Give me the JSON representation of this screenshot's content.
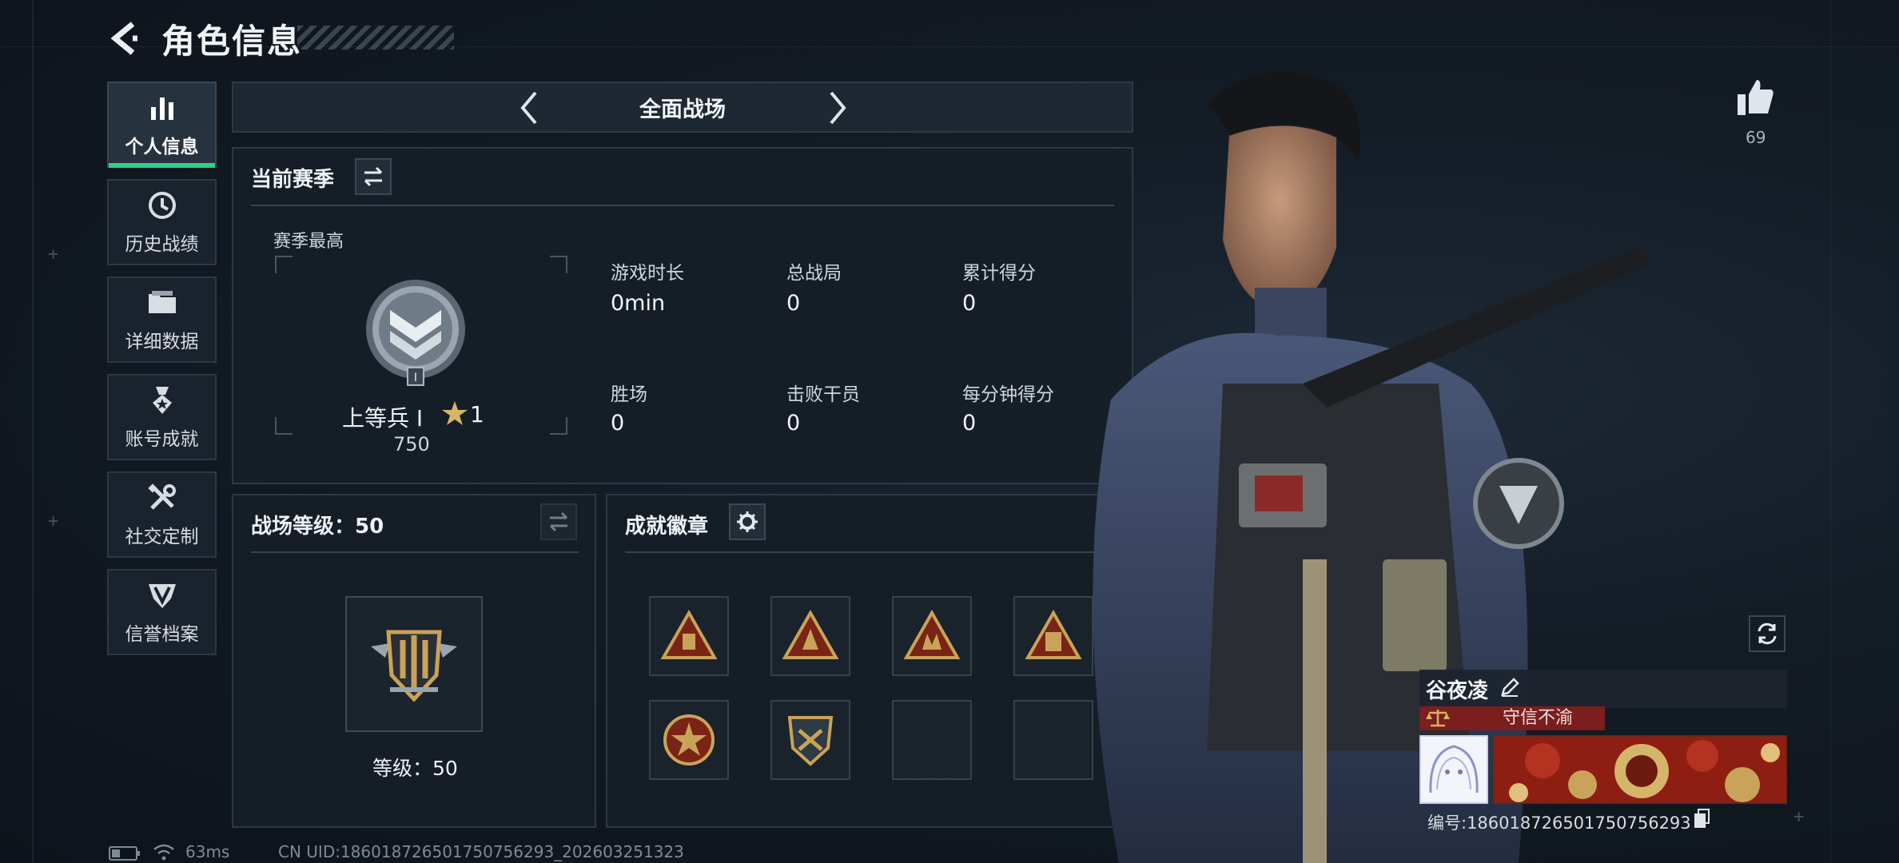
{
  "header": {
    "title": "角色信息"
  },
  "sidebar": {
    "items": [
      {
        "label": "个人信息",
        "icon": "bar-chart-icon"
      },
      {
        "label": "历史战绩",
        "icon": "history-clock-icon"
      },
      {
        "label": "详细数据",
        "icon": "folder-icon"
      },
      {
        "label": "账号成就",
        "icon": "achievement-medal-icon"
      },
      {
        "label": "社交定制",
        "icon": "tools-icon"
      },
      {
        "label": "信誉档案",
        "icon": "credibility-shield-icon"
      }
    ]
  },
  "mode": {
    "title": "全面战场"
  },
  "season": {
    "title": "当前赛季",
    "best_label": "赛季最高",
    "rank_name": "上等兵 Ⅰ",
    "stars": "1",
    "rank_points": "750",
    "stats": [
      {
        "label": "游戏时长",
        "value": "0min"
      },
      {
        "label": "总战局",
        "value": "0"
      },
      {
        "label": "累计得分",
        "value": "0"
      },
      {
        "label": "胜场",
        "value": "0"
      },
      {
        "label": "击败干员",
        "value": "0"
      },
      {
        "label": "每分钟得分",
        "value": "0"
      }
    ]
  },
  "battlefield_level": {
    "title": "战场等级：50",
    "level_text": "等级：50"
  },
  "achievements": {
    "title": "成就徽章"
  },
  "likes": {
    "count": "69"
  },
  "profile": {
    "name": "谷夜凌",
    "trust": "守信不渝",
    "uid": "编号:186018726501750756293"
  },
  "status": {
    "ping": "63ms",
    "uid_line": "CN UID:186018726501750756293_202603251323"
  },
  "colors": {
    "accent": "#2fd08c",
    "trust_bg": "#7a1e1e",
    "gold": "#c9a35a"
  }
}
